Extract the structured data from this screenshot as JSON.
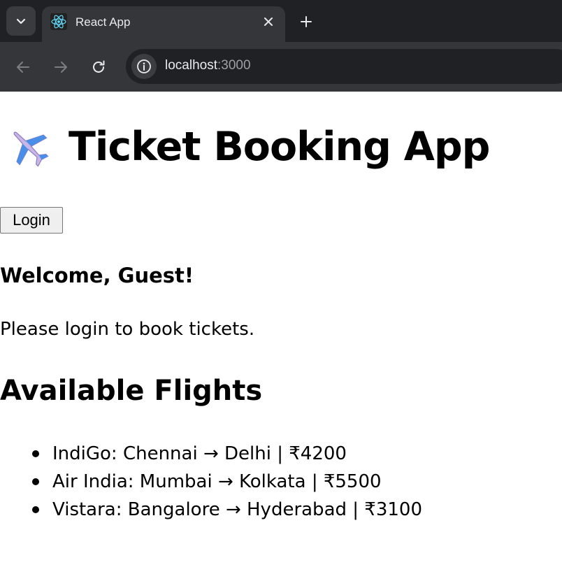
{
  "browser": {
    "tab_title": "React App",
    "url_host": "localhost",
    "url_port": ":3000"
  },
  "app": {
    "title_icon": "airplane-icon",
    "title": "Ticket Booking App",
    "login_label": "Login",
    "welcome": "Welcome, Guest!",
    "login_note": "Please login to book tickets.",
    "flights_heading": "Available Flights",
    "flights": [
      "IndiGo: Chennai → Delhi | ₹4200",
      "Air India: Mumbai → Kolkata | ₹5500",
      "Vistara: Bangalore → Hyderabad | ₹3100"
    ]
  }
}
